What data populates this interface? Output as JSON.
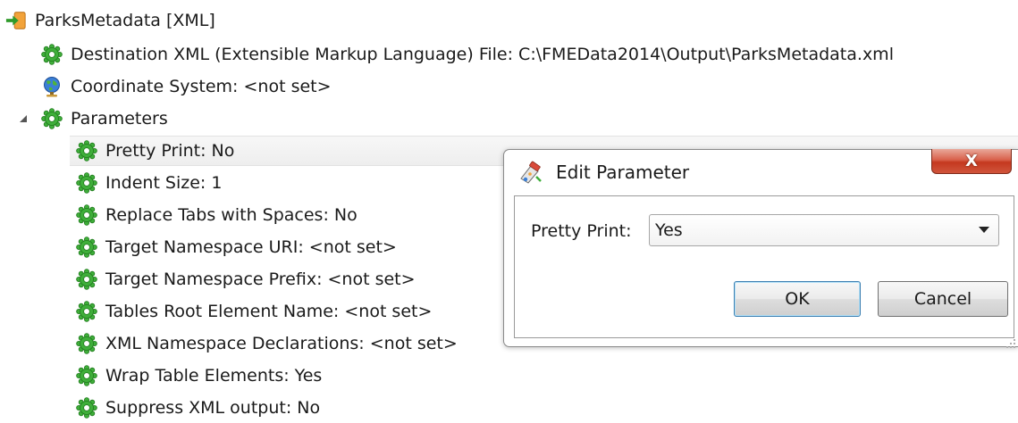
{
  "tree": {
    "root": {
      "label": "ParksMetadata [XML]",
      "icon": "writer-arrow-icon"
    },
    "children": [
      {
        "label": "Destination XML (Extensible Markup Language) File: C:\\FMEData2014\\Output\\ParksMetadata.xml",
        "icon": "gear-icon"
      },
      {
        "label": "Coordinate System: <not set>",
        "icon": "globe-icon"
      },
      {
        "label": "Parameters",
        "icon": "gear-icon",
        "expanded": true
      }
    ],
    "parameters": [
      {
        "label": "Pretty Print: No",
        "selected": true
      },
      {
        "label": "Indent Size: 1"
      },
      {
        "label": "Replace Tabs with Spaces: No"
      },
      {
        "label": "Target Namespace URI: <not set>"
      },
      {
        "label": "Target Namespace Prefix: <not set>"
      },
      {
        "label": "Tables Root Element Name: <not set>"
      },
      {
        "label": "XML Namespace Declarations: <not set>"
      },
      {
        "label": "Wrap Table Elements: Yes"
      },
      {
        "label": "Suppress XML output: No"
      }
    ]
  },
  "dialog": {
    "title": "Edit Parameter",
    "close_label": "X",
    "field_label": "Pretty Print:",
    "field_value": "Yes",
    "ok_label": "OK",
    "cancel_label": "Cancel"
  },
  "colors": {
    "gear": "#3fae3a",
    "close_button": "#c4381f",
    "ok_border": "#3c7fb1"
  }
}
